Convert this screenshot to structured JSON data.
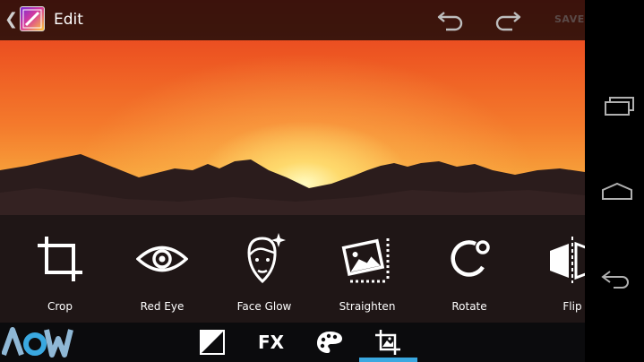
{
  "header": {
    "back_icon": "chevron-left-icon",
    "app_icon": "photo-editor-icon",
    "title": "Edit",
    "undo_icon": "undo-icon",
    "redo_icon": "redo-icon",
    "save_label": "SAVE"
  },
  "tools": [
    {
      "label": "Crop",
      "icon": "crop-icon"
    },
    {
      "label": "Red Eye",
      "icon": "eye-icon"
    },
    {
      "label": "Face Glow",
      "icon": "face-glow-icon"
    },
    {
      "label": "Straighten",
      "icon": "straighten-icon"
    },
    {
      "label": "Rotate",
      "icon": "rotate-icon"
    },
    {
      "label": "Flip",
      "icon": "flip-icon"
    }
  ],
  "bottom_tabs": {
    "exposure_icon": "exposure-icon",
    "fx_label": "FX",
    "palette_icon": "palette-icon",
    "crop_tab_icon": "crop-photo-icon",
    "active_tab": "crop"
  },
  "watermark": "AOW",
  "colors": {
    "accent": "#3aa8e0",
    "topbar": "#160a08"
  },
  "system_nav": [
    "recent-apps-icon",
    "home-icon",
    "back-icon"
  ]
}
